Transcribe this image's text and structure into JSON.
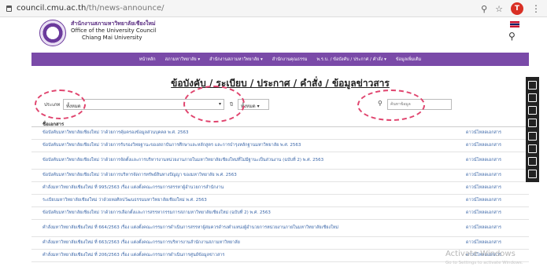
{
  "browser": {
    "url_host": "council.cmu.ac.th",
    "url_path": "/th/news-announce/",
    "profile_initial": "T"
  },
  "header": {
    "org_th": "สำนักงานสภามหาวิทยาลัยเชียงใหม่",
    "org_en1": "Office of the University Council",
    "org_en2": "Chiang Mai University"
  },
  "nav": {
    "items": [
      "หน้าหลัก",
      "สภามหาวิทยาลัย ▾",
      "สำนักงานสภามหาวิทยาลัย ▾",
      "สำนักงานคุณธรรม",
      "พ.ร.บ. / ข้อบังคับ / ประกาศ / คำสั่ง ▾",
      "ข้อมูลเพิ่มเติม"
    ]
  },
  "page": {
    "title": "ข้อบังคับ / ระเบียบ / ประกาศ / คำสั่ง / ข้อมูลข่าวสาร"
  },
  "filters": {
    "type_label": "ประเภท",
    "type_value": "ทั้งหมด",
    "year_label": "ปี",
    "year_value": "ทั้งหมด ▾",
    "search_placeholder": "ค้นหาข้อมูล"
  },
  "table": {
    "header": "ชื่อเอกสาร",
    "rows": [
      {
        "title": "ข้อบังคับมหาวิทยาลัยเชียงใหม่ ว่าด้วยการคุ้มครองข้อมูลส่วนบุคคล พ.ศ. 2563",
        "action": "ดาวน์โหลดเอกสาร"
      },
      {
        "title": "ข้อบังคับมหาวิทยาลัยเชียงใหม่ ว่าด้วยการรับรองวิทยฐานะของสถาบันการศึกษาและหลักสูตร และการบำรุงหลักฐานมหาวิทยาลัย พ.ศ. 2563",
        "action": "ดาวน์โหลดเอกสาร"
      },
      {
        "title": "ข้อบังคับมหาวิทยาลัยเชียงใหม่ ว่าด้วยการจัดตั้งและการบริหารงานหน่วยงานภายในมหาวิทยาลัยเชียงใหม่ที่ไม่มีฐานะเป็นส่วนงาน (ฉบับที่ 2) พ.ศ. 2563",
        "action": "ดาวน์โหลดเอกสาร"
      },
      {
        "title": "ข้อบังคับมหาวิทยาลัยเชียงใหม่ ว่าด้วยการบริหารจัดการทรัพย์สินทางปัญญา ของมหาวิทยาลัย พ.ศ. 2563",
        "action": "ดาวน์โหลดเอกสาร"
      },
      {
        "title": "คำสั่งมหาวิทยาลัยเชียงใหม่ ที่ 995/2563 เรื่อง แต่งตั้งคณะกรรมการสรรหาผู้อำนวยการสำนักงาน",
        "action": "ดาวน์โหลดเอกสาร"
      },
      {
        "title": "ระเบียบมหาวิทยาลัยเชียงใหม่ ว่าด้วยหอศิลปวัฒนธรรมมหาวิทยาลัยเชียงใหม่ พ.ศ. 2563",
        "action": "ดาวน์โหลดเอกสาร"
      },
      {
        "title": "ข้อบังคับมหาวิทยาลัยเชียงใหม่ ว่าด้วยการเลือกตั้งและการสรรหากรรมการสภามหาวิทยาลัยเชียงใหม่ (ฉบับที่ 2) พ.ศ. 2563",
        "action": "ดาวน์โหลดเอกสาร"
      },
      {
        "title": "คำสั่งมหาวิทยาลัยเชียงใหม่ ที่ 664/2563 เรื่อง แต่งตั้งคณะกรรมการดำเนินการสรรหาผู้สมควรดำรงตำแหน่งผู้อำนวยการหน่วยงานภายในมหาวิทยาลัยเชียงใหม่",
        "action": "ดาวน์โหลดเอกสาร"
      },
      {
        "title": "คำสั่งมหาวิทยาลัยเชียงใหม่ ที่ 663/2563 เรื่อง แต่งตั้งคณะกรรมการบริหารงานสำนักงานสภามหาวิทยาลัย",
        "action": "ดาวน์โหลดเอกสาร"
      },
      {
        "title": "คำสั่งมหาวิทยาลัยเชียงใหม่ ที่ 206/2563 เรื่อง แต่งตั้งคณะกรรมการดำเนินการศูนย์ข้อมูลข่าวสาร",
        "action": "ดาวน์โหลดเอกสาร"
      }
    ]
  },
  "watermark": {
    "line1": "Activate Windows",
    "line2": "Go to Settings to activate Windows."
  },
  "colors": {
    "nav": "#7a4aa8",
    "annotation": "#e0446e"
  }
}
